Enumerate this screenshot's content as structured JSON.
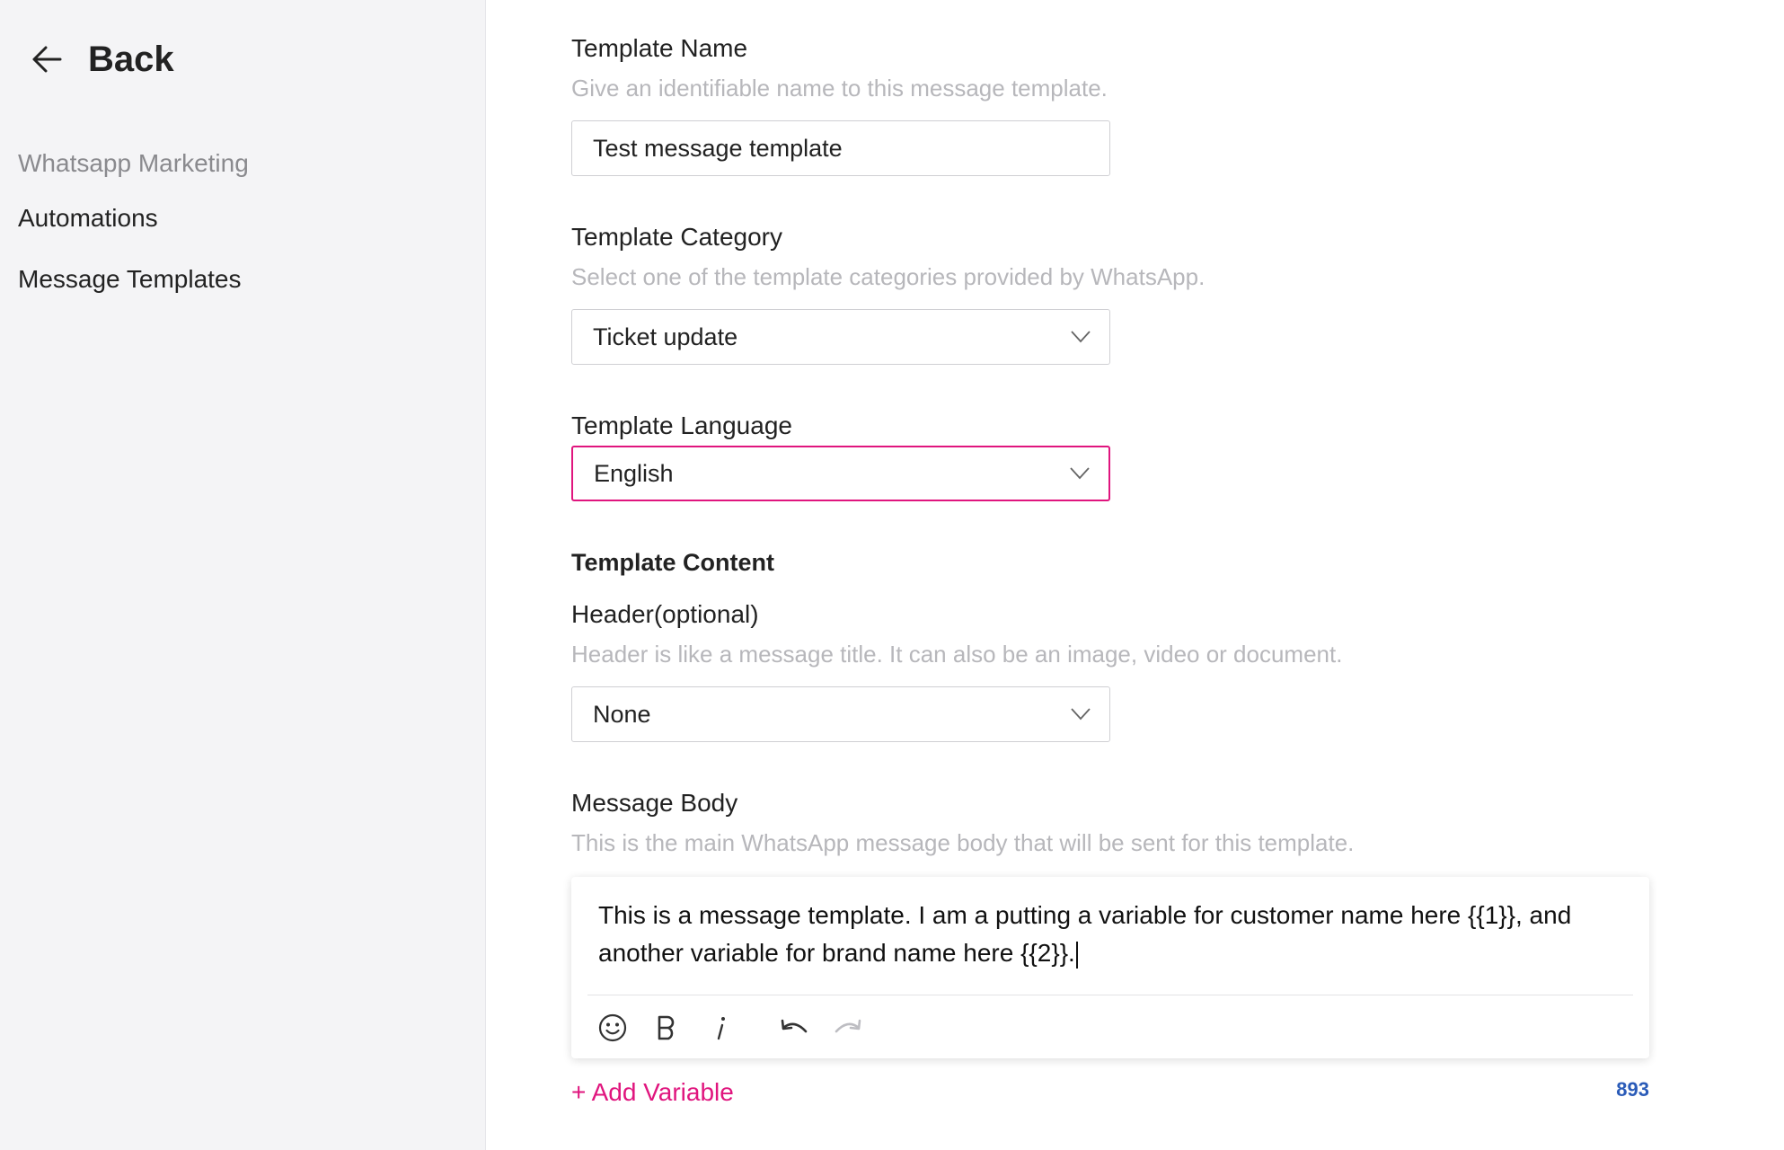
{
  "sidebar": {
    "back_label": "Back",
    "section_title": "Whatsapp Marketing",
    "items": [
      {
        "label": "Automations"
      },
      {
        "label": "Message Templates"
      }
    ]
  },
  "form": {
    "template_name": {
      "label": "Template Name",
      "help": "Give an identifiable name to this message template.",
      "value": "Test message template"
    },
    "template_category": {
      "label": "Template Category",
      "help": "Select one of the template categories provided by WhatsApp.",
      "selected": "Ticket update"
    },
    "template_language": {
      "label": "Template Language",
      "selected": "English"
    },
    "template_content": {
      "title": "Template Content"
    },
    "header": {
      "label": "Header(optional)",
      "help": "Header is like a message title. It can also be an image, video or document.",
      "selected": "None"
    },
    "message_body": {
      "label": "Message Body",
      "help": "This is the main WhatsApp message body that will be sent for this template.",
      "text": "This is a message template. I am a putting a variable for customer name here {{1}}, and another variable for brand name here {{2}}."
    },
    "add_variable_label": "+ Add Variable",
    "char_count": "893"
  },
  "colors": {
    "accent": "#e0157e",
    "counter": "#2a5bb8",
    "sidebar_bg": "#f4f4f6",
    "help_text": "#b7b7bb"
  },
  "icons": {
    "back": "arrow-left-icon",
    "dropdown": "chevron-down-icon",
    "emoji": "smiley-icon",
    "bold": "bold-icon",
    "italic": "italic-icon",
    "undo": "undo-icon",
    "redo": "redo-icon"
  }
}
